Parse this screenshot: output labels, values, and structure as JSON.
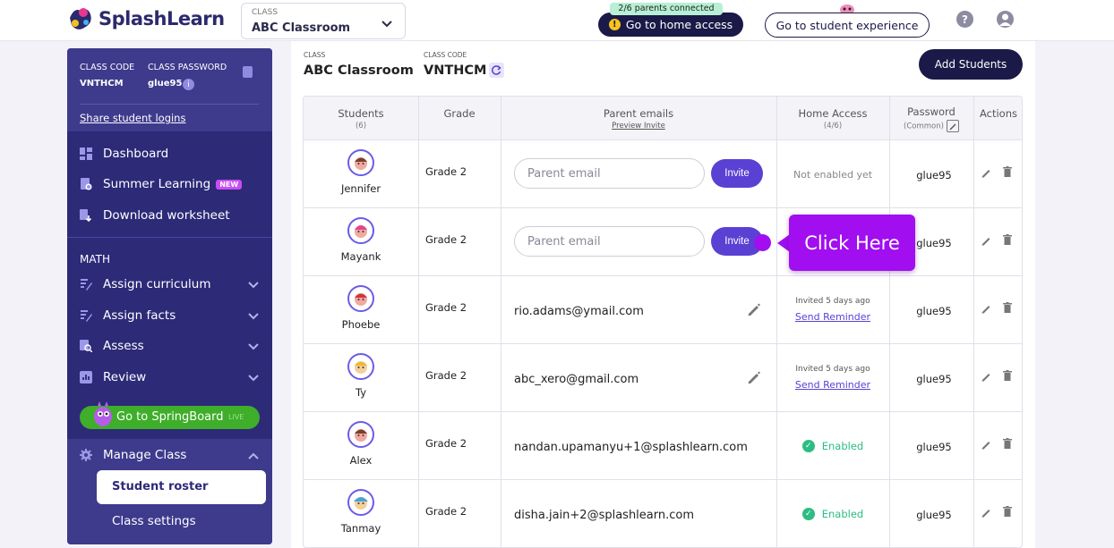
{
  "app": {
    "name": "SplashLearn"
  },
  "topbar": {
    "class_label": "CLASS",
    "class_value": "ABC Classroom",
    "parents_connected": "2/6 parents connected",
    "home_access_label": "Go to home access",
    "student_experience_label": "Go to student experience",
    "help_glyph": "?"
  },
  "sidebar": {
    "class_code_label": "CLASS CODE",
    "class_password_label": "CLASS PASSWORD",
    "class_code_value": "VNTHCM",
    "class_password_value": "glue95",
    "share_logins": "Share student logins",
    "items": [
      {
        "label": "Dashboard",
        "icon": "dashboard-icon"
      },
      {
        "label": "Summer Learning",
        "badge": "NEW",
        "icon": "summer-icon"
      },
      {
        "label": "Download worksheet",
        "icon": "download-icon"
      }
    ],
    "math_heading": "MATH",
    "math_items": [
      {
        "label": "Assign curriculum",
        "icon": "curriculum-icon"
      },
      {
        "label": "Assign facts",
        "icon": "facts-icon"
      },
      {
        "label": "Assess",
        "icon": "assess-icon"
      },
      {
        "label": "Review",
        "icon": "review-icon"
      }
    ],
    "springboard_label": "Go to SpringBoard",
    "springboard_badge": "LIVE",
    "manage_class": "Manage Class",
    "student_roster": "Student roster",
    "class_settings": "Class settings"
  },
  "main": {
    "class_label": "CLASS",
    "class_value": "ABC Classroom",
    "code_label": "CLASS CODE",
    "code_value": "VNTHCM",
    "add_students": "Add Students",
    "columns": {
      "students": "Students",
      "students_count": "(6)",
      "grade": "Grade",
      "parent_emails": "Parent emails",
      "preview_invite": "Preview Invite",
      "home_access": "Home Access",
      "home_access_count": "(4/6)",
      "password": "Password",
      "password_sub": "(Common)",
      "actions": "Actions"
    },
    "rows": [
      {
        "name": "Jennifer",
        "grade": "Grade 2",
        "email": "",
        "placeholder": "Parent email",
        "invite": "Invite",
        "status": "Not enabled yet",
        "password": "glue95"
      },
      {
        "name": "Mayank",
        "grade": "Grade 2",
        "email": "",
        "placeholder": "Parent email",
        "invite": "Invite",
        "status": "",
        "password": "glue95"
      },
      {
        "name": "Phoebe",
        "grade": "Grade 2",
        "email": "rio.adams@ymail.com",
        "invited": "Invited 5 days ago",
        "reminder": "Send Reminder",
        "password": "glue95"
      },
      {
        "name": "Ty",
        "grade": "Grade 2",
        "email": "abc_xero@gmail.com",
        "invited": "Invited 5 days ago",
        "reminder": "Send Reminder",
        "password": "glue95"
      },
      {
        "name": "Alex",
        "grade": "Grade 2",
        "email": "nandan.upamanyu+1@splashlearn.com",
        "enabled": "Enabled",
        "password": "glue95"
      },
      {
        "name": "Tanmay",
        "grade": "Grade 2",
        "email": "disha.jain+2@splashlearn.com",
        "enabled": "Enabled",
        "password": "glue95"
      }
    ]
  },
  "callout": {
    "text": "Click Here"
  },
  "colors": {
    "brand_navy": "#1b1948",
    "sidebar": "#2d2a78",
    "accent_purple": "#5a41d4",
    "callout": "#a10ef0",
    "enabled_green": "#2dbd84",
    "springboard_green": "#3fae2a"
  }
}
